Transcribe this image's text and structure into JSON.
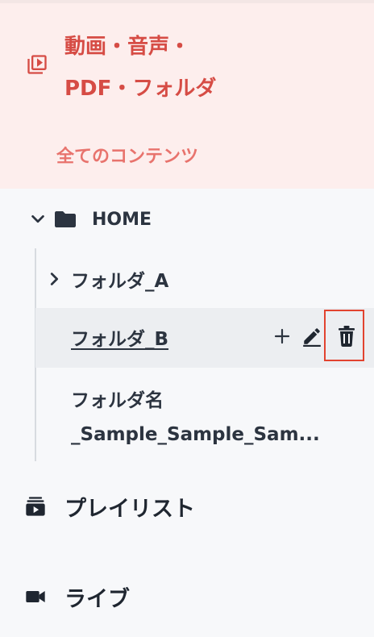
{
  "header": {
    "title_line1": "動画・音声・",
    "title_line2": "PDF・フォルダ",
    "subtitle": "全てのコンテンツ",
    "icon": "video-library-icon",
    "accent_color": "#d64c45",
    "background_color": "#fdeeed"
  },
  "tree": {
    "root_label": "HOME",
    "root_icon": "folder-icon",
    "folders": [
      {
        "label": "フォルダ_A",
        "expandable": true
      },
      {
        "label": "フォルダ_B",
        "selected": true,
        "actions": [
          "plus-icon",
          "pencil-icon",
          "trash-icon"
        ]
      },
      {
        "label": "フォルダ名_Sample_Sample_Sam..."
      }
    ],
    "highlight_color": "#e2432f"
  },
  "nav": {
    "playlist_label": "プレイリスト",
    "playlist_icon": "playlist-icon",
    "live_label": "ライブ",
    "live_icon": "video-camera-icon"
  }
}
